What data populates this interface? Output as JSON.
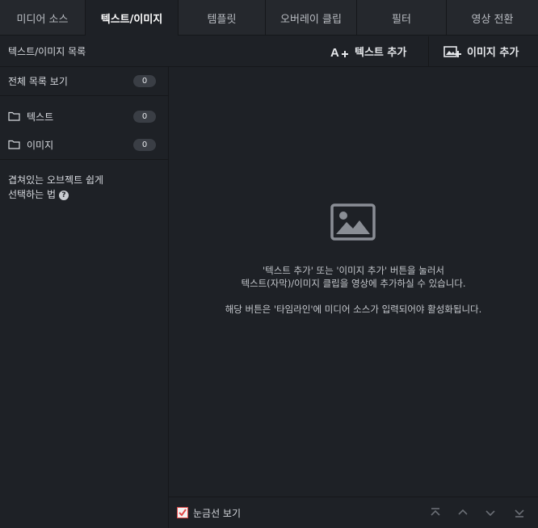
{
  "tabs": [
    {
      "label": "미디어 소스",
      "active": false
    },
    {
      "label": "텍스트/이미지",
      "active": true
    },
    {
      "label": "템플릿",
      "active": false
    },
    {
      "label": "오버레이 클립",
      "active": false
    },
    {
      "label": "필터",
      "active": false
    },
    {
      "label": "영상 전환",
      "active": false
    }
  ],
  "toolbar": {
    "title": "텍스트/이미지 목록",
    "add_text_label": "텍스트 추가",
    "add_image_label": "이미지 추가"
  },
  "sidebar": {
    "all_label": "전체 목록 보기",
    "all_count": "0",
    "items": [
      {
        "label": "텍스트",
        "count": "0"
      },
      {
        "label": "이미지",
        "count": "0"
      }
    ],
    "help_line1": "겹쳐있는 오브젝트 쉽게",
    "help_line2": "선택하는 법",
    "help_icon": "?"
  },
  "main": {
    "empty_line1": "'텍스트 추가' 또는 '이미지 추가' 버튼을 눌러서",
    "empty_line2": "텍스트(자막)/이미지 클립을 영상에 추가하실 수 있습니다.",
    "empty_line3": "해당 버튼은 '타임라인'에 미디어 소스가 입력되어야 활성화됩니다."
  },
  "bottombar": {
    "gridline_label": "눈금선 보기",
    "gridline_checked": true
  },
  "colors": {
    "accent_check": "#e04848",
    "background": "#1e2126",
    "tab_bg": "#25282d"
  }
}
